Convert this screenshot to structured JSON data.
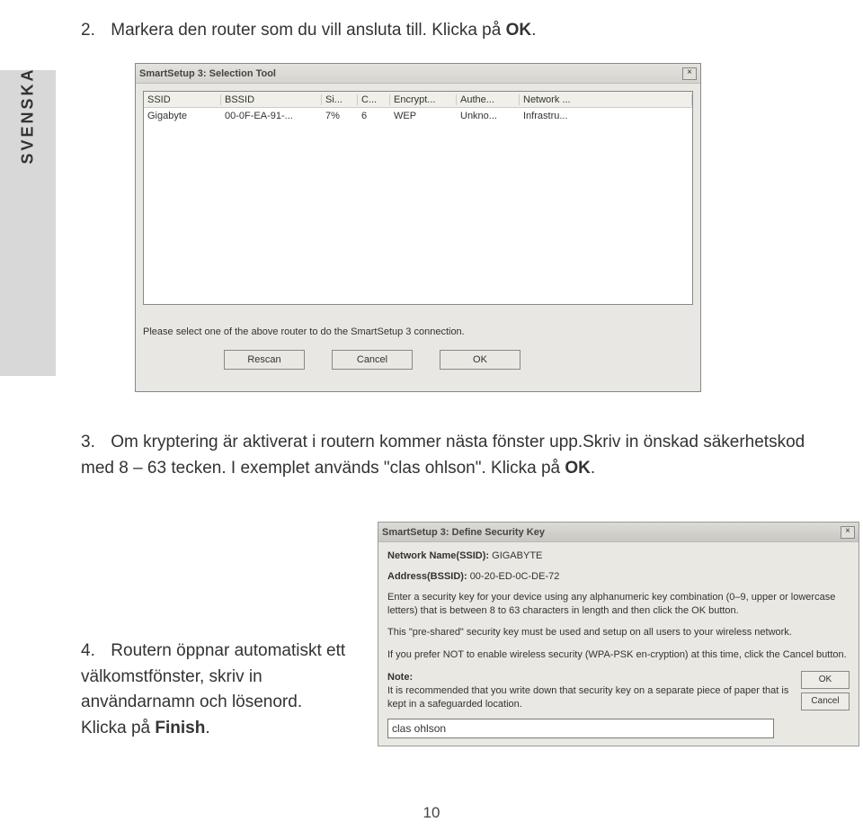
{
  "sidebar": {
    "label": "SVENSKA"
  },
  "step2": {
    "num": "2.",
    "text_prefix": "Markera den router som du vill ansluta till. Klicka på ",
    "ok": "OK",
    "suffix": "."
  },
  "win1": {
    "title": "SmartSetup 3: Selection Tool",
    "close": "×",
    "headers": {
      "ssid": "SSID",
      "bssid": "BSSID",
      "si": "Si...",
      "c": "C...",
      "enc": "Encrypt...",
      "auth": "Authe...",
      "net": "Network ..."
    },
    "row": {
      "ssid": "Gigabyte",
      "bssid": "00-0F-EA-91-...",
      "si": "7%",
      "c": "6",
      "enc": "WEP",
      "auth": "Unkno...",
      "net": "Infrastru..."
    },
    "prompt": "Please select one of the above router to do the SmartSetup 3 connection.",
    "buttons": {
      "rescan": "Rescan",
      "cancel": "Cancel",
      "ok": "OK"
    }
  },
  "step3": {
    "num": "3.",
    "text": "Om kryptering är aktiverat i routern kommer nästa fönster upp.Skriv in önskad säkerhetskod med 8 – 63 tecken. I exemplet används \"clas ohlson\". Klicka på ",
    "ok": "OK",
    "suffix": "."
  },
  "win2": {
    "title": "SmartSetup 3: Define Security Key",
    "close": "×",
    "ssid_label": "Network Name(SSID):",
    "ssid_value": "GIGABYTE",
    "bssid_label": "Address(BSSID):",
    "bssid_value": "00-20-ED-0C-DE-72",
    "p1": "Enter a security key for your device using any alphanumeric key combination (0–9, upper or lowercase letters) that is between 8 to 63 characters in length and then click the OK button.",
    "p2": "This \"pre-shared\" security key must be used and setup on all users to your wireless network.",
    "p3": "If you prefer NOT to enable wireless security (WPA-PSK en-cryption) at this time, click the Cancel button.",
    "note_label": "Note:",
    "note_text": "It is recommended that you write down that security key on a separate piece of paper that is kept in a safeguarded location.",
    "input_value": "clas ohlson",
    "buttons": {
      "ok": "OK",
      "cancel": "Cancel"
    }
  },
  "step4": {
    "num": "4.",
    "text": "Routern öppnar automatiskt ett välkomstfönster, skriv in användarnamn och lösenord. Klicka på ",
    "finish": "Finish",
    "suffix": "."
  },
  "page_number": "10"
}
